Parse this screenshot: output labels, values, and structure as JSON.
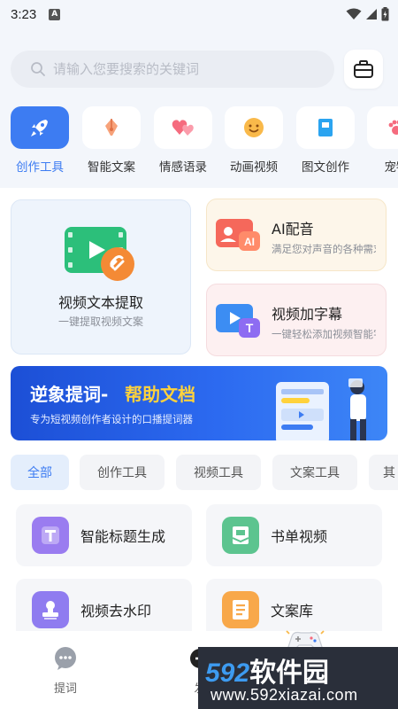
{
  "status_bar": {
    "time": "3:23",
    "notification_letter": "A"
  },
  "search": {
    "placeholder": "请输入您要搜索的关键词",
    "value": ""
  },
  "categories": [
    {
      "label": "创作工具",
      "icon": "rocket-icon",
      "active": true
    },
    {
      "label": "智能文案",
      "icon": "pen-nib-icon"
    },
    {
      "label": "情感语录",
      "icon": "hearts-icon"
    },
    {
      "label": "动画视频",
      "icon": "smiley-icon"
    },
    {
      "label": "图文创作",
      "icon": "book-icon"
    },
    {
      "label": "宠物",
      "icon": "paw-icon"
    }
  ],
  "featured": {
    "extract": {
      "title": "视频文本提取",
      "subtitle": "一键提取视频文案"
    },
    "dubbing": {
      "title": "AI配音",
      "subtitle": "满足您对声音的各种需求",
      "icon_text": "AI"
    },
    "subtitles": {
      "title": "视频加字幕",
      "subtitle": "一键轻松添加视频智能字幕",
      "icon_text": "T"
    }
  },
  "banner": {
    "title_part1": "逆象提词-",
    "title_part2": "帮助文档",
    "subtitle": "专为短视频创作者设计的口播提词器",
    "colors": {
      "start": "#1c4fd6",
      "end": "#3d86f7",
      "highlight": "#ffd23c"
    }
  },
  "tabs": [
    "全部",
    "创作工具",
    "视频工具",
    "文案工具",
    "其"
  ],
  "tools": [
    {
      "label": "智能标题生成",
      "icon": "title-t-icon",
      "color": "#9a7cf0"
    },
    {
      "label": "书单视频",
      "icon": "book-list-icon",
      "color": "#5cc48f"
    },
    {
      "label": "视频去水印",
      "icon": "stamp-icon",
      "color": "#8f7cf0"
    },
    {
      "label": "文案库",
      "icon": "document-icon",
      "color": "#f8a84a"
    }
  ],
  "bottom_nav": [
    {
      "label": "提词",
      "icon": "chat-bubble-icon"
    },
    {
      "label": "发",
      "icon": "publish-icon"
    }
  ],
  "watermark": {
    "brand_num": "592",
    "brand_cn": "软件园",
    "url": "www.592xiazai.com"
  },
  "colors": {
    "accent": "#3d7cf2",
    "page_bg": "#f3f6fb"
  }
}
